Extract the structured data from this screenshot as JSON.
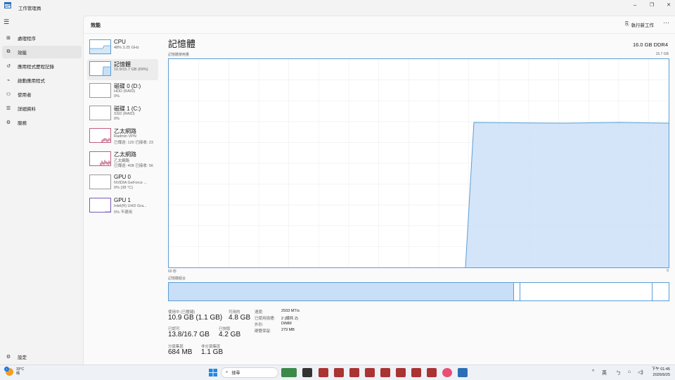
{
  "window": {
    "title": "工作管理員",
    "controls": [
      "–",
      "❐",
      "✕"
    ]
  },
  "nav": {
    "items": [
      {
        "label": "處理程序",
        "icon": "grid-icon"
      },
      {
        "label": "效能",
        "icon": "performance-icon"
      },
      {
        "label": "應用程式歷程記錄",
        "icon": "history-icon"
      },
      {
        "label": "啟動應用程式",
        "icon": "startup-icon"
      },
      {
        "label": "使用者",
        "icon": "users-icon"
      },
      {
        "label": "詳細資料",
        "icon": "details-icon"
      },
      {
        "label": "服務",
        "icon": "services-icon"
      }
    ],
    "settings_label": "設定"
  },
  "header": {
    "title": "效能",
    "run_task_label": "執行新工作",
    "more_label": "···"
  },
  "devices": [
    {
      "name": "CPU",
      "line1": "48% 3.25 GHz",
      "line2": ""
    },
    {
      "name": "記憶體",
      "line1": "10.9/15.7 GB (69%)",
      "line2": ""
    },
    {
      "name": "磁碟 0 (D:)",
      "line1": "HDD (RAID)",
      "line2": "0%"
    },
    {
      "name": "磁碟 1 (C:)",
      "line1": "SSD (RAID)",
      "line2": "0%"
    },
    {
      "name": "乙太網路",
      "line1": "Radmin VPN",
      "line2": "已傳送: 120 已接收: 23"
    },
    {
      "name": "乙太網路",
      "line1": "乙太網路",
      "line2": "已傳送: 408 已接收: 56"
    },
    {
      "name": "GPU 0",
      "line1": "NVIDIA GeForce ...",
      "line2": "0% (38 °C)"
    },
    {
      "name": "GPU 1",
      "line1": "Intel(R) UHD Gra...",
      "line2": "5% 不適用"
    }
  ],
  "detail": {
    "title": "記憶體",
    "spec": "16.0 GB DDR4",
    "graph_label": "記憶體使用量",
    "graph_max": "15.7 GB",
    "time_left": "60 秒",
    "time_right": "0",
    "composition_label": "記憶體組合",
    "in_use_fraction": 0.69
  },
  "stats": {
    "in_use_label": "使用中 (已壓縮)",
    "in_use_value": "10.9 GB (1.1 GB)",
    "available_label": "可用的",
    "available_value": "4.8 GB",
    "committed_label": "已認可",
    "committed_value": "13.8/16.7 GB",
    "cached_label": "已快取",
    "cached_value": "4.2 GB",
    "paged_label": "分頁集區",
    "paged_value": "684 MB",
    "nonpaged_label": "非分頁集區",
    "nonpaged_value": "1.1 GB",
    "speed_label": "速度:",
    "speed_value": "2933 MT/s",
    "slots_label": "已使用插槽:",
    "slots_value": "2 (總共 2)",
    "form_label": "外形:",
    "form_value": "DIMM",
    "reserved_label": "硬體保留:",
    "reserved_value": "279 MB"
  },
  "taskbar": {
    "temp": "33°C",
    "weather": "晴",
    "badge": "1",
    "search_placeholder": "搜尋",
    "tray_lang": "英",
    "time": "下午 01:45",
    "date": "2026/9/25"
  },
  "colors": {
    "accent": "#5a9ed6",
    "memory_fill": "#c9dff7",
    "network_pink": "#c06080"
  }
}
